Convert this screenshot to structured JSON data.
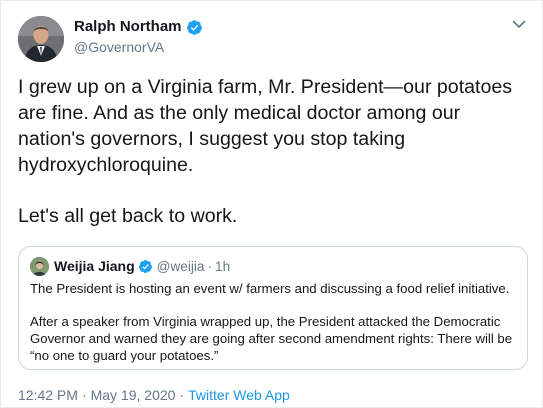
{
  "tweet": {
    "author": {
      "display_name": "Ralph Northam",
      "handle": "@GovernorVA",
      "verified": true,
      "avatar_icon": "avatar-photo-icon"
    },
    "text_paragraph_1": "I grew up on a Virginia farm, Mr. President—our potatoes are fine. And as the only medical doctor among our nation's governors, I suggest you stop taking hydroxychloroquine.",
    "text_paragraph_2": "Let's all get back to work.",
    "quoted_tweet": {
      "display_name": "Weijia Jiang",
      "handle": "@weijia",
      "separator": "·",
      "time": "1h",
      "verified": true,
      "paragraph_1": "The President is hosting an event w/ farmers and discussing a food relief initiative.",
      "paragraph_2": "After a speaker from Virginia wrapped up, the President attacked the Democratic Governor and warned they are going after second amendment rights: There will be “no one to guard your potatoes.”"
    },
    "meta": {
      "time": "12:42 PM",
      "separator": "·",
      "date": "May 19, 2020",
      "source": "Twitter Web App"
    }
  },
  "colors": {
    "text_primary": "#14171a",
    "text_secondary": "#657786",
    "link": "#1b95e0",
    "verified_badge": "#1da1f2",
    "border": "#ccd6dd"
  },
  "icons": {
    "verified": "verified-badge-icon",
    "caret": "chevron-down-icon"
  }
}
